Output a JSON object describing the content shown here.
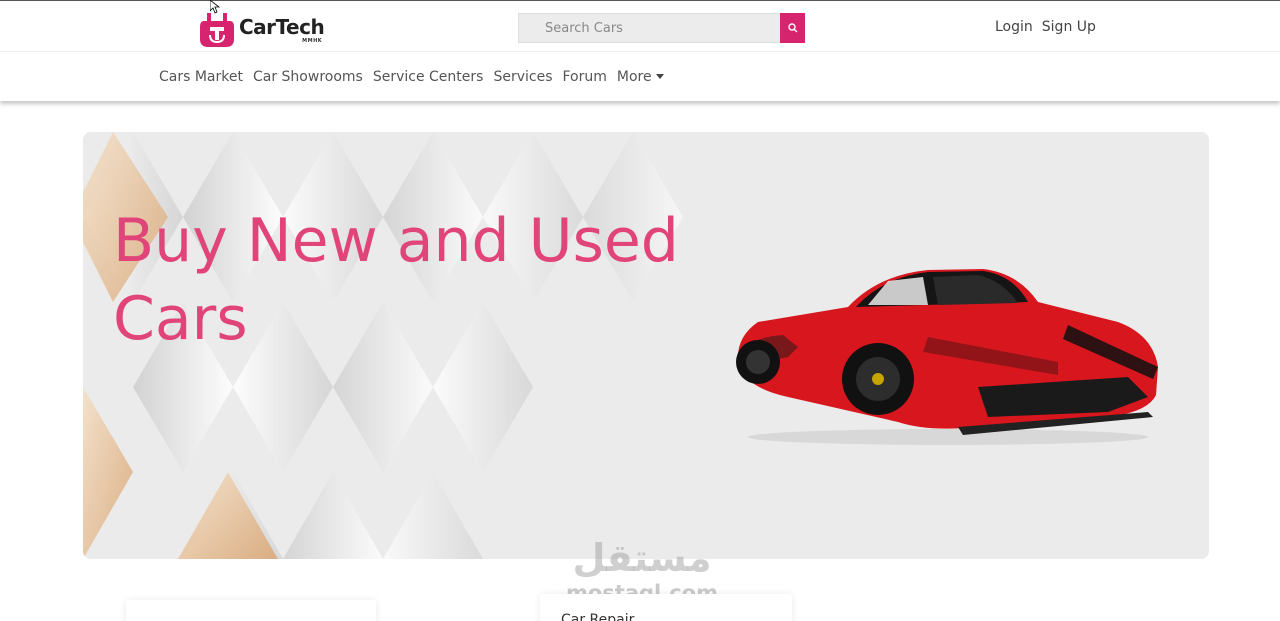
{
  "header": {
    "logo": {
      "name": "CarTech",
      "sub": "MMHK"
    },
    "search": {
      "placeholder": "Search Cars"
    },
    "auth": {
      "login": "Login",
      "signup": "Sign Up"
    }
  },
  "nav": {
    "items": [
      {
        "label": "Cars Market"
      },
      {
        "label": "Car Showrooms"
      },
      {
        "label": "Service Centers"
      },
      {
        "label": "Services"
      },
      {
        "label": "Forum"
      },
      {
        "label": "More"
      }
    ]
  },
  "hero": {
    "title": "Buy New and Used Cars"
  },
  "cards": [
    {
      "title": ""
    },
    {
      "title": "Car Repair"
    }
  ],
  "watermark": {
    "arabic": "مستقل",
    "latin": "mostaql.com"
  },
  "colors": {
    "accent": "#d6246e",
    "heroText": "#e04478"
  },
  "icons": {
    "search": "search-icon",
    "caret": "caret-down-icon",
    "car": "car-image"
  }
}
